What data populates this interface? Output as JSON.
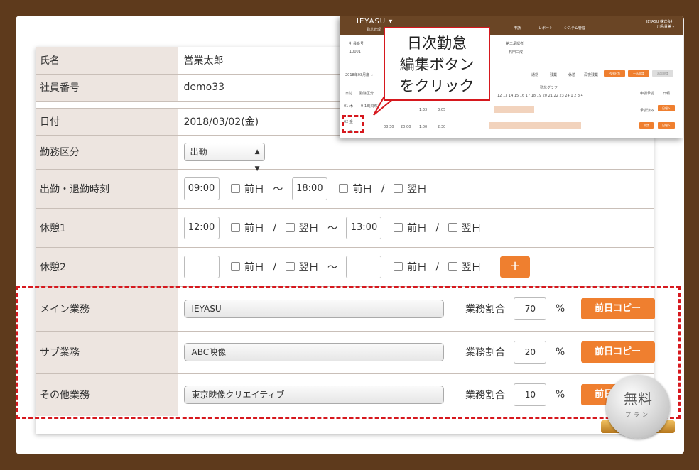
{
  "form": {
    "name_label": "氏名",
    "name_value": "営業太郎",
    "empno_label": "社員番号",
    "empno_value": "demo33",
    "date_label": "日付",
    "date_value": "2018/03/02(金)",
    "kind_label": "勤務区分",
    "kind_value": "出勤",
    "inout_label": "出勤・退勤時刻",
    "in_time": "09:00",
    "out_time": "18:00",
    "break1_label": "休憩1",
    "break1_start": "12:00",
    "break1_end": "13:00",
    "break2_label": "休憩2",
    "prev_day": "前日",
    "next_day": "翌日",
    "slash": "/",
    "tilde": "～",
    "plus": "+",
    "ratio_label": "業務割合",
    "percent": "%",
    "copy_label": "前日コピー",
    "main_label": "メイン業務",
    "main_value": "IEYASU",
    "main_ratio": "70",
    "sub_label": "サブ業務",
    "sub_value": "ABC映像",
    "sub_ratio": "20",
    "other_label": "その他業務",
    "other_value": "東京映像クリエイティブ",
    "other_ratio": "10"
  },
  "callout": {
    "line1": "日次勤怠",
    "line2": "編集ボタン",
    "line3": "をクリック"
  },
  "mini": {
    "logo": "IEYASU ▾",
    "logo_sub": "勤怠管理",
    "nav": [
      "申請",
      "レポート",
      "システム管理"
    ],
    "company": "IEYASU 株式会社",
    "user": "川島貴美 ▾",
    "emp_hdr": "社員番号",
    "emp_no": "10001",
    "approver_hdr": "第二承認者",
    "approver": "石田三成",
    "period": "2018年03月度 ◂",
    "legend": [
      "通常",
      "残業",
      "休憩",
      "深夜残業"
    ],
    "pdf_btn": "PDF出力",
    "batch_btn": "一括申請",
    "cancel_btn": "承認申請",
    "col_day": "日付",
    "col_kind": "勤務区分",
    "col_graph": "勤怠グラフ",
    "col_apply": "申請承認",
    "col_op": "日報",
    "hours": "12 13 14 15 16 17 18 19 20 21 22 23 24 1 2 3 4",
    "r1_day": "01 木",
    "r1_kind": "9-18(飛布)",
    "r1_a": "1:33",
    "r1_b": "3:05",
    "r1_status": "承認済み",
    "r1_btn": "日報へ",
    "r2_day": "02 金",
    "r2_in": "08:30",
    "r2_out": "20:00",
    "r2_a": "1:00",
    "r2_b": "2:30",
    "r2_btn1": "申請",
    "r2_btn2": "日報へ"
  },
  "seal": {
    "title": "無料",
    "sub": "プラン"
  }
}
